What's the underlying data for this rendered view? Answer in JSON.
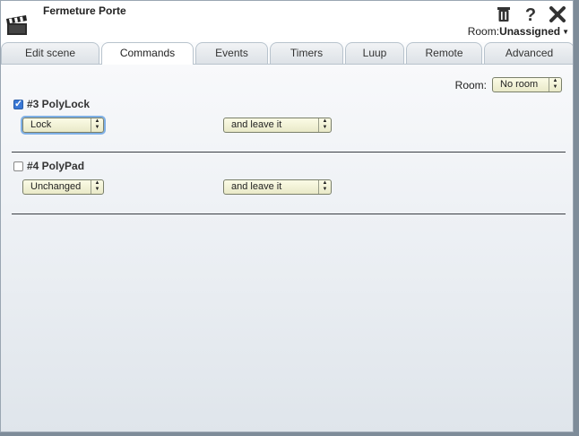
{
  "header": {
    "title": "Fermeture Porte",
    "room_prefix": "Room:",
    "room_value": "Unassigned",
    "icons": [
      "scene-clapper-icon",
      "trash-icon",
      "help-icon",
      "close-icon"
    ]
  },
  "tabs": [
    {
      "label": "Edit scene",
      "active": false
    },
    {
      "label": "Commands",
      "active": true
    },
    {
      "label": "Events",
      "active": false
    },
    {
      "label": "Timers",
      "active": false
    },
    {
      "label": "Luup",
      "active": false
    },
    {
      "label": "Remote",
      "active": false
    },
    {
      "label": "Advanced",
      "active": false
    }
  ],
  "filter": {
    "room_label": "Room:",
    "room_value": "No room"
  },
  "devices": [
    {
      "name": "#3 PolyLock",
      "checked": true,
      "command": "Lock",
      "after": "and leave it"
    },
    {
      "name": "#4 PolyPad",
      "checked": false,
      "command": "Unchanged",
      "after": "and leave it"
    }
  ]
}
